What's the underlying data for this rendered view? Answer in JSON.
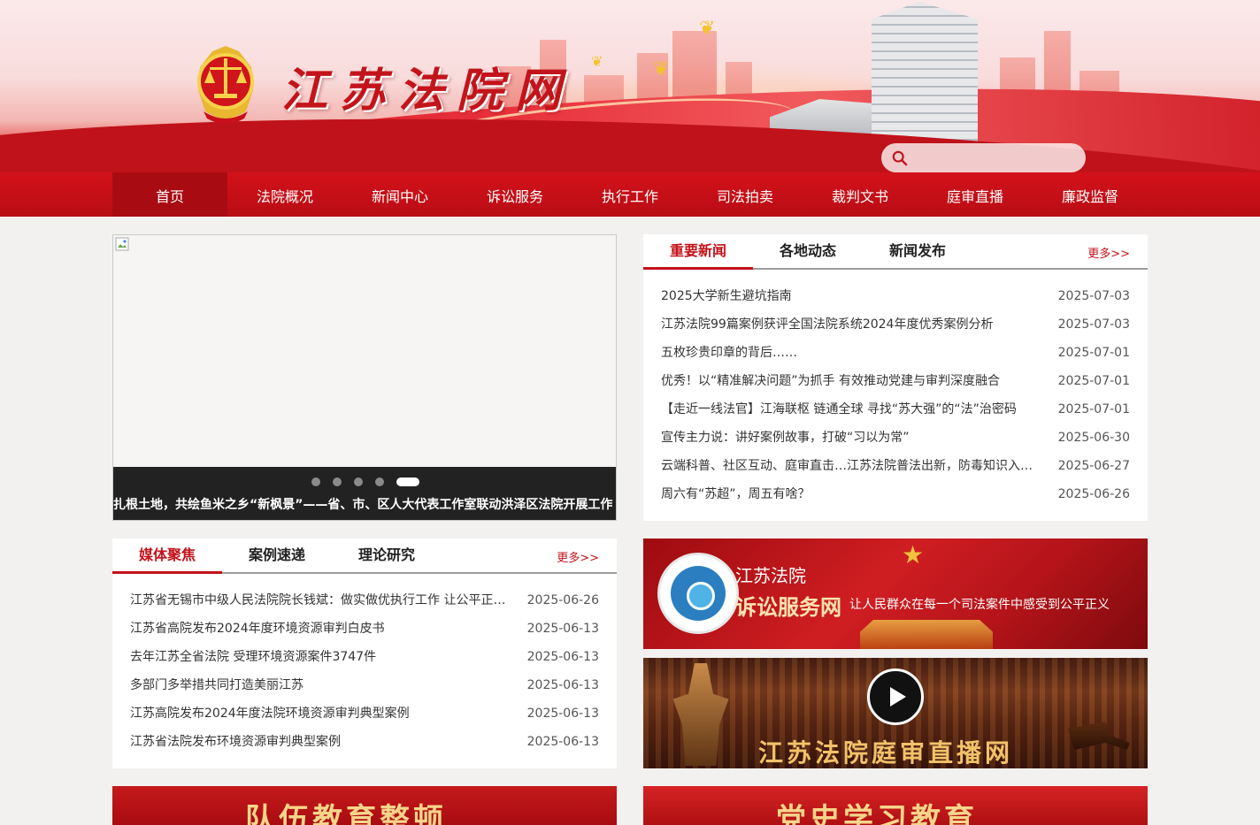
{
  "header": {
    "site_title": "江苏法院网",
    "search": {
      "placeholder": "",
      "value": ""
    },
    "colors": {
      "primary_red": "#c3121a",
      "nav_red": "#d3111a",
      "gold": "#f2c230"
    }
  },
  "nav": {
    "items": [
      {
        "label": "首页",
        "active": true
      },
      {
        "label": "法院概况"
      },
      {
        "label": "新闻中心"
      },
      {
        "label": "诉讼服务"
      },
      {
        "label": "执行工作"
      },
      {
        "label": "司法拍卖"
      },
      {
        "label": "裁判文书"
      },
      {
        "label": "庭审直播"
      },
      {
        "label": "廉政监督"
      }
    ]
  },
  "slider": {
    "caption": "扎根土地，共绘鱼米之乡“新枫景”——省、市、区人大代表工作室联动洪泽区法院开展工作",
    "slide_count": 5,
    "active_index": 4
  },
  "news_panel": {
    "tabs": [
      "重要新闻",
      "各地动态",
      "新闻发布"
    ],
    "active_tab": 0,
    "more_label": "更多>>",
    "items": [
      {
        "title": "2025大学新生避坑指南",
        "date": "2025-07-03"
      },
      {
        "title": "江苏法院99篇案例获评全国法院系统2024年度优秀案例分析",
        "date": "2025-07-03"
      },
      {
        "title": "五枚珍贵印章的背后……",
        "date": "2025-07-01"
      },
      {
        "title": "优秀！以“精准解决问题”为抓手 有效推动党建与审判深度融合",
        "date": "2025-07-01"
      },
      {
        "title": "【走近一线法官】江海联枢 链通全球 寻找“苏大强”的“法”治密码",
        "date": "2025-07-01"
      },
      {
        "title": "宣传主力说：讲好案例故事，打破“习以为常”",
        "date": "2025-06-30"
      },
      {
        "title": "云端科普、社区互动、庭审直击…江苏法院普法出新，防毒知识入脑入心",
        "date": "2025-06-27"
      },
      {
        "title": "周六有“苏超”，周五有啥？",
        "date": "2025-06-26"
      }
    ]
  },
  "media_panel": {
    "tabs": [
      "媒体聚焦",
      "案例速递",
      "理论研究"
    ],
    "active_tab": 0,
    "more_label": "更多>>",
    "items": [
      {
        "title": "江苏省无锡市中级人民法院院长钱斌：做实做优执行工作 让公平正义可感可触",
        "date": "2025-06-26"
      },
      {
        "title": "江苏省高院发布2024年度环境资源审判白皮书",
        "date": "2025-06-13"
      },
      {
        "title": "去年江苏全省法院 受理环境资源案件3747件",
        "date": "2025-06-13"
      },
      {
        "title": "多部门多举措共同打造美丽江苏",
        "date": "2025-06-13"
      },
      {
        "title": "江苏高院发布2024年度法院环境资源审判典型案例",
        "date": "2025-06-13"
      },
      {
        "title": "江苏省法院发布环境资源审判典型案例",
        "date": "2025-06-13"
      }
    ]
  },
  "promos": {
    "service": {
      "line1": "江苏法院",
      "line2": "诉讼服务网",
      "slogan": "让人民群众在每一个司法案件中感受到公平正义"
    },
    "live": {
      "title": "江苏法院庭审直播网"
    },
    "bottom_left": {
      "title": "队伍教育整顿"
    },
    "bottom_right": {
      "title": "党史学习教育"
    }
  }
}
